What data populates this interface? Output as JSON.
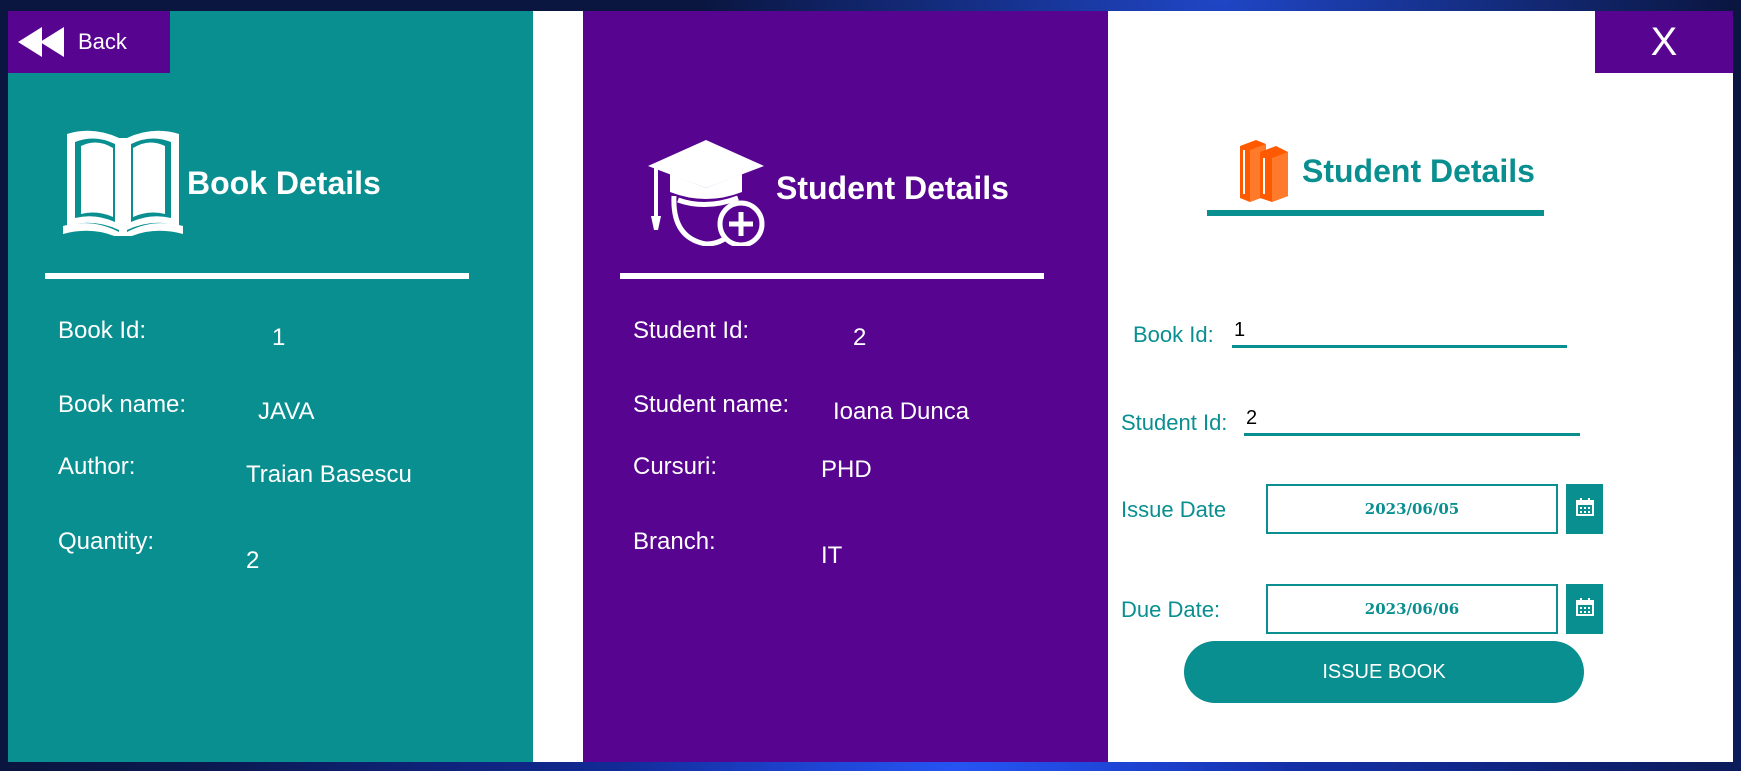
{
  "colors": {
    "teal": "#0a8f90",
    "purple": "#570490",
    "white": "#ffffff",
    "orange": "#ff5a00"
  },
  "nav": {
    "back_label": "Back",
    "close_label": "X"
  },
  "book_panel": {
    "title": "Book Details",
    "icon": "open-book-icon",
    "fields": {
      "id_label": "Book Id:",
      "id_value": "1",
      "name_label": "Book name:",
      "name_value": "JAVA",
      "author_label": "Author:",
      "author_value": "Traian Basescu",
      "quantity_label": "Quantity:",
      "quantity_value": "2"
    }
  },
  "student_panel": {
    "title": "Student Details",
    "icon": "graduate-add-icon",
    "fields": {
      "id_label": "Student Id:",
      "id_value": "2",
      "name_label": "Student name:",
      "name_value": "Ioana Dunca",
      "courses_label": "Cursuri:",
      "courses_value": "PHD",
      "branch_label": "Branch:",
      "branch_value": "IT"
    }
  },
  "issue_form": {
    "title": "Student Details",
    "icon": "books-icon",
    "book_id_label": "Book Id:",
    "book_id_value": "1",
    "student_id_label": "Student Id:",
    "student_id_value": "2",
    "issue_date_label": "Issue Date",
    "issue_date_value": "2023/06/05",
    "due_date_label": "Due Date:",
    "due_date_value": "2023/06/06",
    "submit_label": "ISSUE BOOK"
  }
}
